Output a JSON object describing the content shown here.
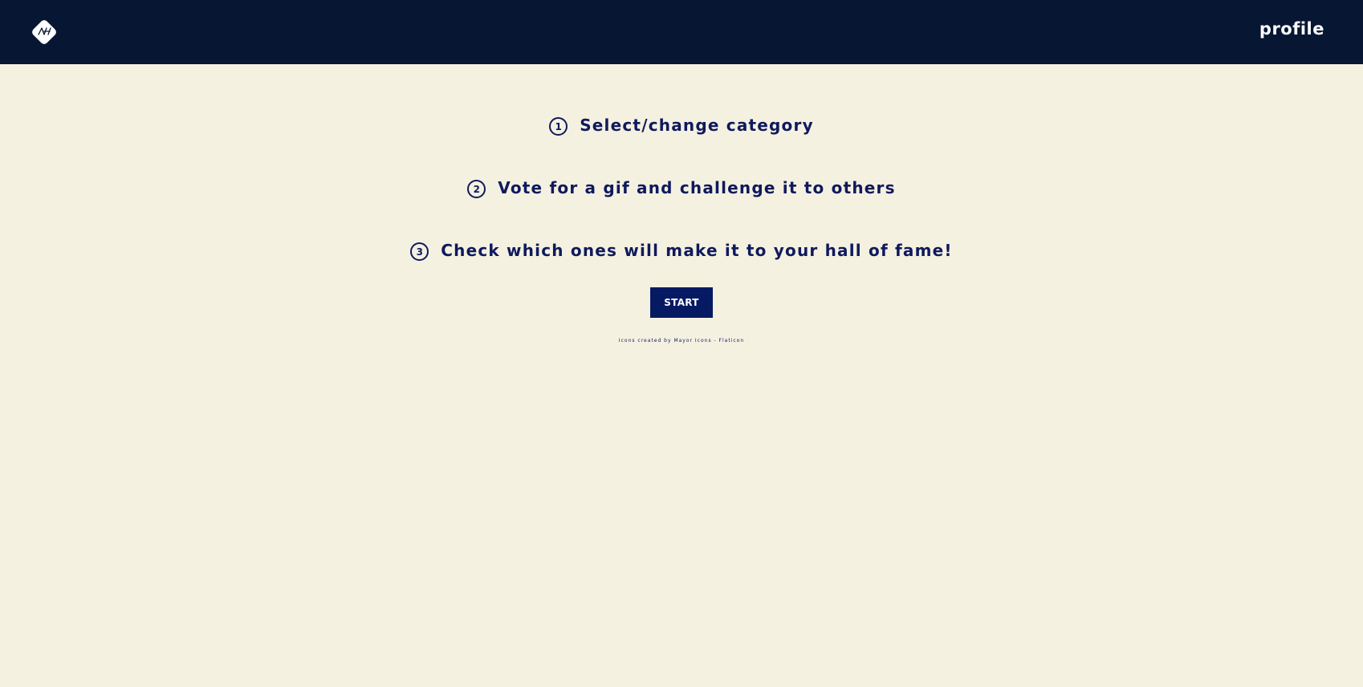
{
  "header": {
    "logo_icon": "gif-logo-icon",
    "profile_link": "profile"
  },
  "steps": [
    {
      "number": "1",
      "text": "Select/change category"
    },
    {
      "number": "2",
      "text": "Vote for a gif and challenge it to others"
    },
    {
      "number": "3",
      "text": "Check which ones will make it to your hall of fame!"
    }
  ],
  "start_button": "START",
  "credit": "Icons created by Mayor Icons - Flaticon",
  "colors": {
    "navbar": "#071633",
    "background": "#f5f1e1",
    "text": "#0f1a5c",
    "button": "#061a63"
  }
}
